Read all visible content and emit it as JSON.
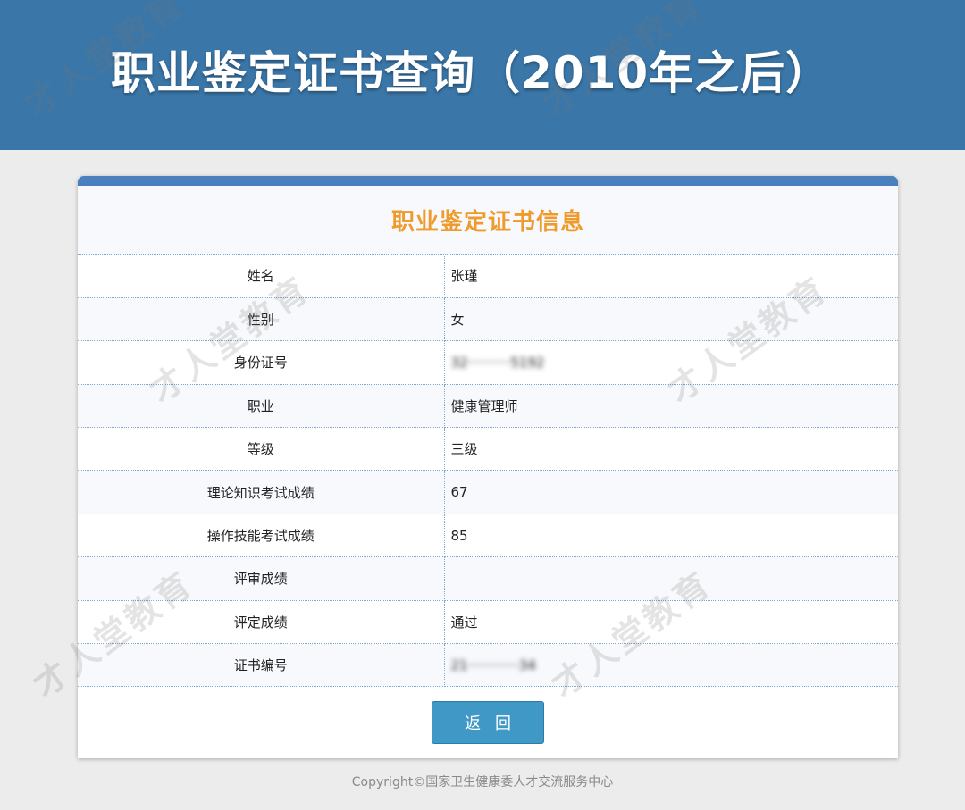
{
  "header": {
    "title": "职业鉴定证书查询（2010年之后）"
  },
  "panel": {
    "title": "职业鉴定证书信息",
    "rows": [
      {
        "label": "姓名",
        "value": "张瑾"
      },
      {
        "label": "性别",
        "value": "女"
      },
      {
        "label": "身份证号",
        "value": "32··········5192",
        "blurred": true
      },
      {
        "label": "职业",
        "value": "健康管理师"
      },
      {
        "label": "等级",
        "value": "三级"
      },
      {
        "label": "理论知识考试成绩",
        "value": "67"
      },
      {
        "label": "操作技能考试成绩",
        "value": "85"
      },
      {
        "label": "评审成绩",
        "value": ""
      },
      {
        "label": "评定成绩",
        "value": "通过"
      },
      {
        "label": "证书编号",
        "value": "21············34",
        "blurred": true
      }
    ],
    "back_label": "返回"
  },
  "footer": {
    "copyright": "Copyright©国家卫生健康委人才交流服务中心"
  },
  "watermark": "才人堂教育",
  "colors": {
    "header_bg": "#3a76a8",
    "title_accent": "#ef9a2a",
    "button_bg": "#3f98c5"
  }
}
